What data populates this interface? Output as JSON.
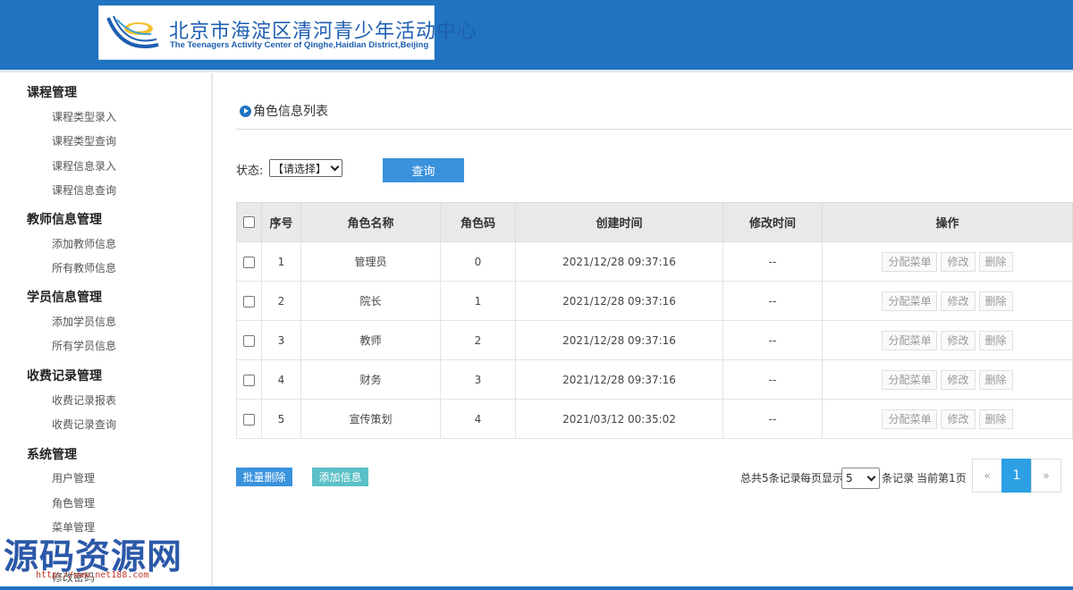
{
  "header": {
    "logo_cn": "北京市海淀区清河青少年活动中心",
    "logo_en": "The Teenagers Activity Center of Qinghe,Haidian District,Beijing"
  },
  "sidebar": {
    "groups": [
      {
        "title": "课程管理",
        "items": [
          "课程类型录入",
          "课程类型查询",
          "课程信息录入",
          "课程信息查询"
        ]
      },
      {
        "title": "教师信息管理",
        "items": [
          "添加教师信息",
          "所有教师信息"
        ]
      },
      {
        "title": "学员信息管理",
        "items": [
          "添加学员信息",
          "所有学员信息"
        ]
      },
      {
        "title": "收费记录管理",
        "items": [
          "收费记录报表",
          "收费记录查询"
        ]
      },
      {
        "title": "系统管理",
        "items": [
          "用户管理",
          "角色管理",
          "菜单管理",
          "修改密码"
        ]
      }
    ]
  },
  "main": {
    "title": "角色信息列表",
    "filter": {
      "label": "状态:",
      "selected": "【请选择】",
      "query_button": "查询"
    },
    "table": {
      "headers": [
        "序号",
        "角色名称",
        "角色码",
        "创建时间",
        "修改时间",
        "操作"
      ],
      "rows": [
        {
          "index": "1",
          "name": "管理员",
          "code": "0",
          "created": "2021/12/28 09:37:16",
          "modified": "--"
        },
        {
          "index": "2",
          "name": "院长",
          "code": "1",
          "created": "2021/12/28 09:37:16",
          "modified": "--"
        },
        {
          "index": "3",
          "name": "教师",
          "code": "2",
          "created": "2021/12/28 09:37:16",
          "modified": "--"
        },
        {
          "index": "4",
          "name": "财务",
          "code": "3",
          "created": "2021/12/28 09:37:16",
          "modified": "--"
        },
        {
          "index": "5",
          "name": "宣传策划",
          "code": "4",
          "created": "2021/03/12 00:35:02",
          "modified": "--"
        }
      ],
      "actions": [
        "分配菜单",
        "修改",
        "删除"
      ]
    },
    "bottom": {
      "batch_delete": "批量删除",
      "add_info": "添加信息"
    },
    "pager": {
      "total_text": "总共5条记录",
      "per_page_label": "每页显示",
      "per_page_value": "5",
      "records_suffix": "条记录",
      "current_text": "当前第1页",
      "prev": "«",
      "page": "1",
      "next": "»"
    }
  },
  "watermark": {
    "text": "源码资源网",
    "url": "http://www.net188.com"
  },
  "colors": {
    "header": "#1f73c0",
    "primary_button": "#3a92dd",
    "secondary_button": "#5bc0c8",
    "active_page": "#2d9fe3"
  }
}
